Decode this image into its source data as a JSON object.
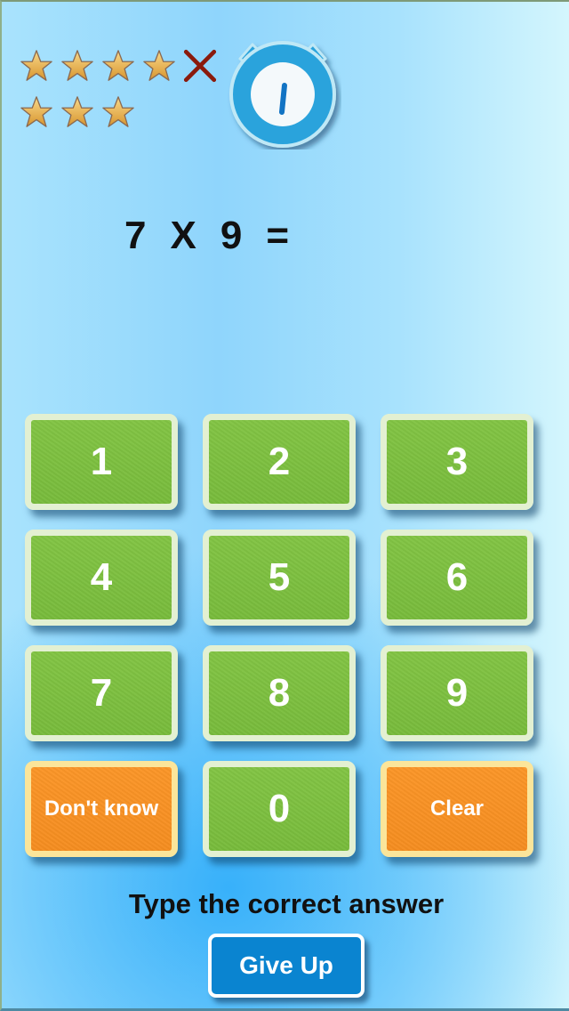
{
  "score": {
    "results": [
      "correct",
      "correct",
      "correct",
      "correct",
      "wrong",
      "correct",
      "correct",
      "correct"
    ],
    "correct_count": 7,
    "wrong_count": 1,
    "star_color": "#e9b24a",
    "wrong_color": "#8a1a0c"
  },
  "timer": {
    "icon": "stopwatch-icon",
    "ring_color": "#2ba3dc",
    "hand_color": "#1274c4"
  },
  "question": {
    "operand_a": "7",
    "operator": "X",
    "operand_b": "9",
    "equals": "=",
    "answer": ""
  },
  "keypad": {
    "keys": [
      {
        "label": "1",
        "type": "digit"
      },
      {
        "label": "2",
        "type": "digit"
      },
      {
        "label": "3",
        "type": "digit"
      },
      {
        "label": "4",
        "type": "digit"
      },
      {
        "label": "5",
        "type": "digit"
      },
      {
        "label": "6",
        "type": "digit"
      },
      {
        "label": "7",
        "type": "digit"
      },
      {
        "label": "8",
        "type": "digit"
      },
      {
        "label": "9",
        "type": "digit"
      },
      {
        "label": "Don't know",
        "type": "action"
      },
      {
        "label": "0",
        "type": "digit"
      },
      {
        "label": "Clear",
        "type": "action"
      }
    ],
    "digit_color": "#7fc242",
    "action_color": "#f7901f"
  },
  "instruction": "Type the correct answer",
  "give_up_label": "Give Up",
  "give_up_color": "#0a84d0"
}
